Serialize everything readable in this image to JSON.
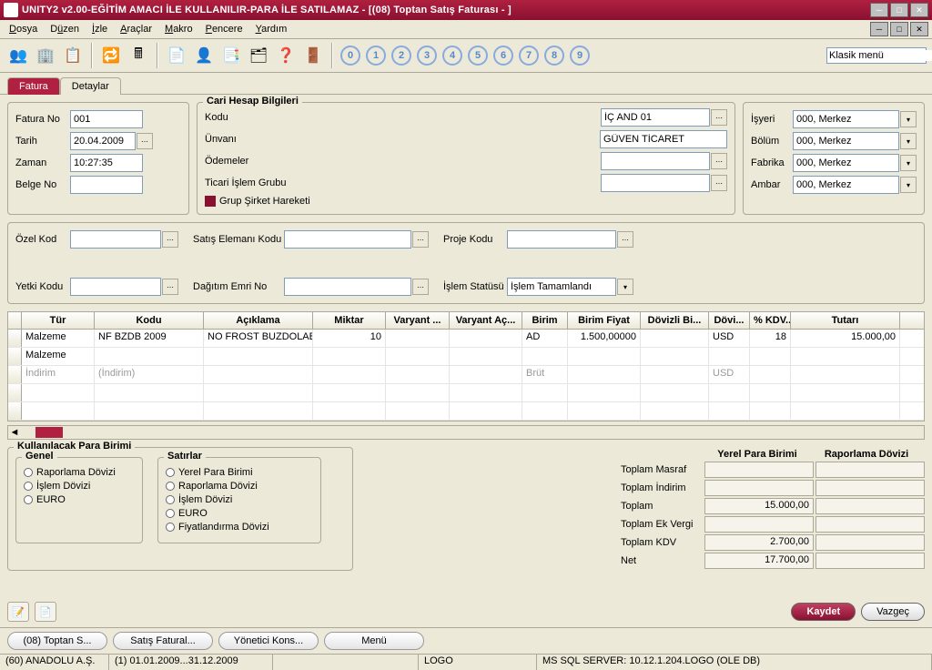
{
  "window": {
    "title": "UNITY2 v2.00-EĞİTİM AMACI İLE KULLANILIR-PARA İLE SATILAMAZ - [(08) Toptan Satış Faturası - ]"
  },
  "menu": {
    "items": [
      "Dosya",
      "Düzen",
      "İzle",
      "Araçlar",
      "Makro",
      "Pencere",
      "Yardım"
    ]
  },
  "toolbar": {
    "classic": "Klasik menü",
    "numbers": [
      "0",
      "1",
      "2",
      "3",
      "4",
      "5",
      "6",
      "7",
      "8",
      "9"
    ]
  },
  "tabs": {
    "fatura": "Fatura",
    "detaylar": "Detaylar"
  },
  "header": {
    "fatura_no_label": "Fatura No",
    "fatura_no": "001",
    "tarih_label": "Tarih",
    "tarih": "20.04.2009",
    "zaman_label": "Zaman",
    "zaman": "10:27:35",
    "belge_no_label": "Belge No",
    "belge_no": ""
  },
  "cari": {
    "title": "Cari Hesap Bilgileri",
    "kodu_label": "Kodu",
    "kodu": "İÇ AND 01",
    "unvani_label": "Ünvanı",
    "unvani": "GÜVEN TİCARET",
    "odemeler_label": "Ödemeler",
    "odemeler": "",
    "ticari_label": "Ticari İşlem Grubu",
    "ticari": "",
    "grup_label": "Grup Şirket Hareketi"
  },
  "org": {
    "isyeri_label": "İşyeri",
    "isyeri": "000, Merkez",
    "bolum_label": "Bölüm",
    "bolum": "000, Merkez",
    "fabrika_label": "Fabrika",
    "fabrika": "000, Merkez",
    "ambar_label": "Ambar",
    "ambar": "000, Merkez"
  },
  "codes": {
    "ozel_label": "Özel Kod",
    "ozel": "",
    "yetki_label": "Yetki Kodu",
    "yetki": "",
    "satis_label": "Satış Elemanı Kodu",
    "satis": "",
    "dagitim_label": "Dağıtım Emri No",
    "dagitim": "",
    "proje_label": "Proje Kodu",
    "proje": "",
    "islem_label": "İşlem Statüsü",
    "islem": "İşlem Tamamlandı"
  },
  "grid": {
    "headers": [
      "Tür",
      "Kodu",
      "Açıklama",
      "Miktar",
      "Varyant ...",
      "Varyant Aç...",
      "Birim",
      "Birim Fiyat",
      "Dövizli Bi...",
      "Dövi...",
      "% KDV...",
      "Tutarı"
    ],
    "rows": [
      {
        "tur": "Malzeme",
        "kodu": "NF BZDB 2009",
        "aciklama": "NO FROST BUZDOLABI",
        "miktar": "10",
        "v1": "",
        "v2": "",
        "birim": "AD",
        "bfiyat": "1.500,00000",
        "dbi": "",
        "dov": "USD",
        "kdv": "18",
        "tutar": "15.000,00"
      },
      {
        "tur": "Malzeme",
        "kodu": "",
        "aciklama": "",
        "miktar": "",
        "v1": "",
        "v2": "",
        "birim": "",
        "bfiyat": "",
        "dbi": "",
        "dov": "",
        "kdv": "",
        "tutar": ""
      },
      {
        "tur": "İndirim",
        "kodu": "(İndirim)",
        "aciklama": "",
        "miktar": "",
        "v1": "",
        "v2": "",
        "birim": "Brüt",
        "bfiyat": "",
        "dbi": "",
        "dov": "USD",
        "kdv": "",
        "tutar": "",
        "grey": true
      },
      {
        "tur": "",
        "kodu": "",
        "aciklama": "",
        "miktar": "",
        "v1": "",
        "v2": "",
        "birim": "",
        "bfiyat": "",
        "dbi": "",
        "dov": "",
        "kdv": "",
        "tutar": ""
      },
      {
        "tur": "",
        "kodu": "",
        "aciklama": "",
        "miktar": "",
        "v1": "",
        "v2": "",
        "birim": "",
        "bfiyat": "",
        "dbi": "",
        "dov": "",
        "kdv": "",
        "tutar": ""
      }
    ]
  },
  "currency": {
    "title": "Kullanılacak Para Birimi",
    "genel_title": "Genel",
    "genel": [
      "Raporlama Dövizi",
      "İşlem Dövizi",
      "EURO"
    ],
    "satirlar_title": "Satırlar",
    "satirlar": [
      "Yerel Para Birimi",
      "Raporlama Dövizi",
      "İşlem Dövizi",
      "EURO",
      "Fiyatlandırma Dövizi"
    ]
  },
  "totals": {
    "h1": "Yerel Para Birimi",
    "h2": "Raporlama Dövizi",
    "masraf_label": "Toplam Masraf",
    "masraf1": "",
    "masraf2": "",
    "indirim_label": "Toplam İndirim",
    "indirim1": "",
    "indirim2": "",
    "toplam_label": "Toplam",
    "toplam1": "15.000,00",
    "toplam2": "",
    "ekvergi_label": "Toplam Ek Vergi",
    "ekvergi1": "",
    "ekvergi2": "",
    "kdv_label": "Toplam KDV",
    "kdv1": "2.700,00",
    "kdv2": "",
    "net_label": "Net",
    "net1": "17.700,00",
    "net2": ""
  },
  "actions": {
    "kaydet": "Kaydet",
    "vazgec": "Vazgeç"
  },
  "taskbar": [
    "(08) Toptan S...",
    "Satış Fatural...",
    "Yönetici Kons...",
    "Menü"
  ],
  "status": {
    "company": "(60) ANADOLU A.Ş.",
    "period": "(1) 01.01.2009...31.12.2009",
    "logo": "LOGO",
    "db": "MS SQL SERVER: 10.12.1.204.LOGO (OLE DB)"
  }
}
